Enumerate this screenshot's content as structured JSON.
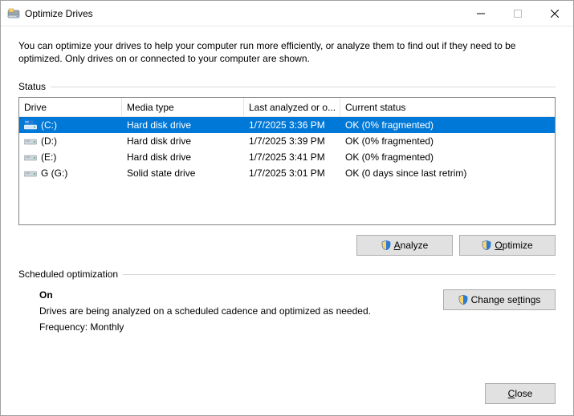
{
  "window": {
    "title": "Optimize Drives"
  },
  "intro": "You can optimize your drives to help your computer run more efficiently, or analyze them to find out if they need to be optimized. Only drives on or connected to your computer are shown.",
  "status_label": "Status",
  "columns": {
    "drive": "Drive",
    "media": "Media type",
    "last": "Last analyzed or o...",
    "status": "Current status"
  },
  "rows": [
    {
      "name": "(C:)",
      "media": "Hard disk drive",
      "last": "1/7/2025 3:36 PM",
      "status": "OK (0% fragmented)",
      "selected": true,
      "icon": "hdd-windows"
    },
    {
      "name": "(D:)",
      "media": "Hard disk drive",
      "last": "1/7/2025 3:39 PM",
      "status": "OK (0% fragmented)",
      "selected": false,
      "icon": "hdd"
    },
    {
      "name": "(E:)",
      "media": "Hard disk drive",
      "last": "1/7/2025 3:41 PM",
      "status": "OK (0% fragmented)",
      "selected": false,
      "icon": "hdd"
    },
    {
      "name": "G (G:)",
      "media": "Solid state drive",
      "last": "1/7/2025 3:01 PM",
      "status": "OK (0 days since last retrim)",
      "selected": false,
      "icon": "ssd"
    }
  ],
  "buttons": {
    "analyze": "Analyze",
    "optimize": "Optimize",
    "change_settings": "Change settings",
    "close": "Close"
  },
  "scheduled": {
    "label": "Scheduled optimization",
    "on": "On",
    "desc": "Drives are being analyzed on a scheduled cadence and optimized as needed.",
    "freq": "Frequency: Monthly"
  }
}
